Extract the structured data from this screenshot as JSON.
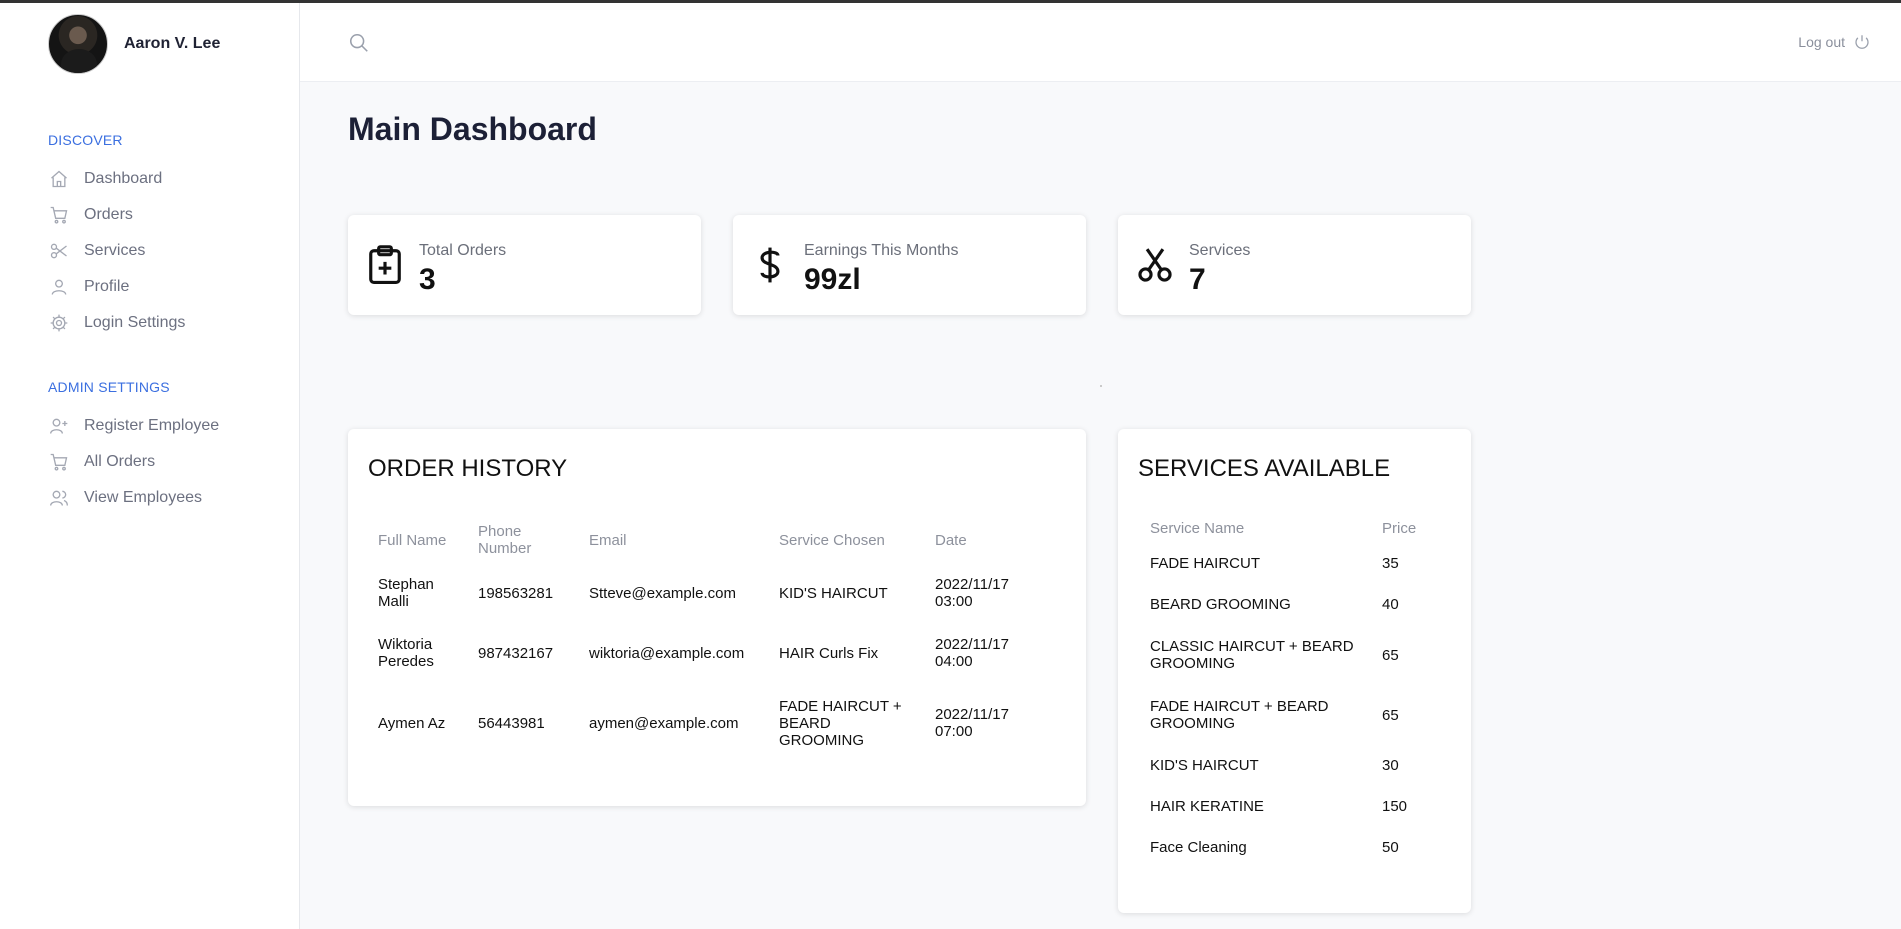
{
  "sidebar": {
    "user_name": "Aaron V. Lee",
    "sections": [
      {
        "title": "DISCOVER",
        "items": [
          {
            "label": "Dashboard",
            "icon": "home-icon"
          },
          {
            "label": "Orders",
            "icon": "cart-icon"
          },
          {
            "label": "Services",
            "icon": "scissors-icon"
          },
          {
            "label": "Profile",
            "icon": "user-icon"
          },
          {
            "label": "Login Settings",
            "icon": "gear-icon"
          }
        ]
      },
      {
        "title": "ADMIN SETTINGS",
        "items": [
          {
            "label": "Register Employee",
            "icon": "user-plus-icon"
          },
          {
            "label": "All Orders",
            "icon": "cart-icon"
          },
          {
            "label": "View Employees",
            "icon": "users-icon"
          }
        ]
      }
    ]
  },
  "header": {
    "logout_label": "Log out"
  },
  "main": {
    "title": "Main Dashboard",
    "stats": [
      {
        "label": "Total Orders",
        "value": "3",
        "icon": "clipboard-plus-icon"
      },
      {
        "label": "Earnings This Months",
        "value": "99zl",
        "icon": "dollar-icon"
      },
      {
        "label": "Services",
        "value": "7",
        "icon": "scissors-icon"
      }
    ],
    "order_history": {
      "title": "ORDER HISTORY",
      "columns": [
        "Full Name",
        "Phone Number",
        "Email",
        "Service Chosen",
        "Date"
      ],
      "rows": [
        [
          "Stephan Malli",
          "198563281",
          "Stteve@example.com",
          "KID'S HAIRCUT",
          "2022/11/17 03:00"
        ],
        [
          "Wiktoria Peredes",
          "987432167",
          "wiktoria@example.com",
          "HAIR Curls Fix",
          "2022/11/17 04:00"
        ],
        [
          "Aymen Az",
          "56443981",
          "aymen@example.com",
          "FADE HAIRCUT + BEARD GROOMING",
          "2022/11/17 07:00"
        ]
      ]
    },
    "services_available": {
      "title": "SERVICES AVAILABLE",
      "columns": [
        "Service Name",
        "Price"
      ],
      "rows": [
        [
          "FADE HAIRCUT",
          "35"
        ],
        [
          "BEARD GROOMING",
          "40"
        ],
        [
          "CLASSIC HAIRCUT + BEARD GROOMING",
          "65"
        ],
        [
          "FADE HAIRCUT + BEARD GROOMING",
          "65"
        ],
        [
          "KID'S HAIRCUT",
          "30"
        ],
        [
          "HAIR KERATINE",
          "150"
        ],
        [
          "Face Cleaning",
          "50"
        ]
      ]
    }
  },
  "colors": {
    "accent": "#3b6fe0",
    "background": "#f8f9fb",
    "muted_text": "#8d919c"
  }
}
